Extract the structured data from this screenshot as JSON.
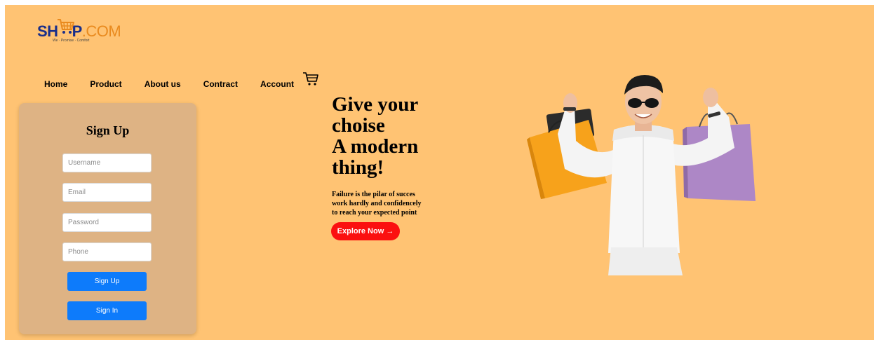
{
  "logo": {
    "prefix": "SH",
    "letter": "P",
    "suffix": ".COM",
    "tagline": "We · Promise · Comfort"
  },
  "nav": {
    "items": [
      {
        "label": "Home"
      },
      {
        "label": "Product"
      },
      {
        "label": "About us"
      },
      {
        "label": "Contract"
      },
      {
        "label": "Account"
      }
    ]
  },
  "signup": {
    "title": "Sign Up",
    "fields": {
      "username_placeholder": "Username",
      "email_placeholder": "Email",
      "password_placeholder": "Password",
      "phone_placeholder": "Phone"
    },
    "signup_label": "Sign Up",
    "signin_label": "Sign In"
  },
  "hero": {
    "title_lines": [
      "Give your",
      "choise",
      "A modern",
      "thing!"
    ],
    "subtitle_lines": [
      "Failure is the pilar of succes",
      "work hardly and confidencely",
      "to reach your expected point"
    ],
    "cta_label": "Explore Now →"
  },
  "colors": {
    "background": "#ffc373",
    "card": "#deb384",
    "button": "#0d7bfb",
    "cta": "#fb1010",
    "logo_blue": "#1a2f8a",
    "logo_orange": "#e98a1e"
  },
  "icons": {
    "logo_cart": "shopping-cart-icon",
    "nav_cart": "shopping-cart-icon"
  }
}
